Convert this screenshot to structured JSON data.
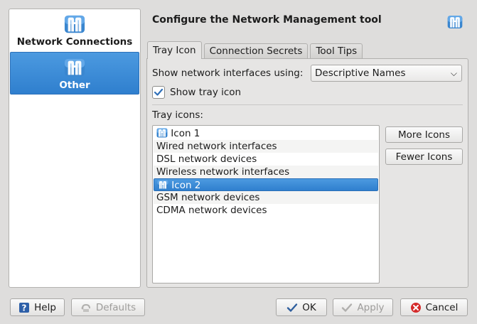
{
  "sidebar": {
    "items": [
      {
        "label": "Network Connections",
        "icon": "network-management-icon",
        "selected": false
      },
      {
        "label": "Other",
        "icon": "network-management-icon",
        "selected": true
      }
    ]
  },
  "header": {
    "title": "Configure the Network Management tool",
    "icon": "network-management-icon"
  },
  "tabs": [
    {
      "label": "Tray Icon",
      "active": true
    },
    {
      "label": "Connection Secrets",
      "active": false
    },
    {
      "label": "Tool Tips",
      "active": false
    }
  ],
  "tray_tab": {
    "show_interfaces_label": "Show network interfaces using:",
    "show_interfaces_value": "Descriptive Names",
    "show_tray_icon_label": "Show tray icon",
    "show_tray_icon_checked": true,
    "tray_icons_label": "Tray icons:",
    "list": [
      "Icon 1",
      "Wired network interfaces",
      "DSL network devices",
      "Wireless network interfaces",
      "Icon 2",
      "GSM network devices",
      "CDMA network devices"
    ],
    "selected_index": 4,
    "more_icons_label": "More Icons",
    "fewer_icons_label": "Fewer Icons"
  },
  "footer": {
    "help_label": "Help",
    "defaults_label": "Defaults",
    "ok_label": "OK",
    "apply_label": "Apply",
    "cancel_label": "Cancel"
  },
  "colors": {
    "selection": "#3b8bd8",
    "window_bg": "#dedddc",
    "icon_blue": "#2b79c2"
  }
}
